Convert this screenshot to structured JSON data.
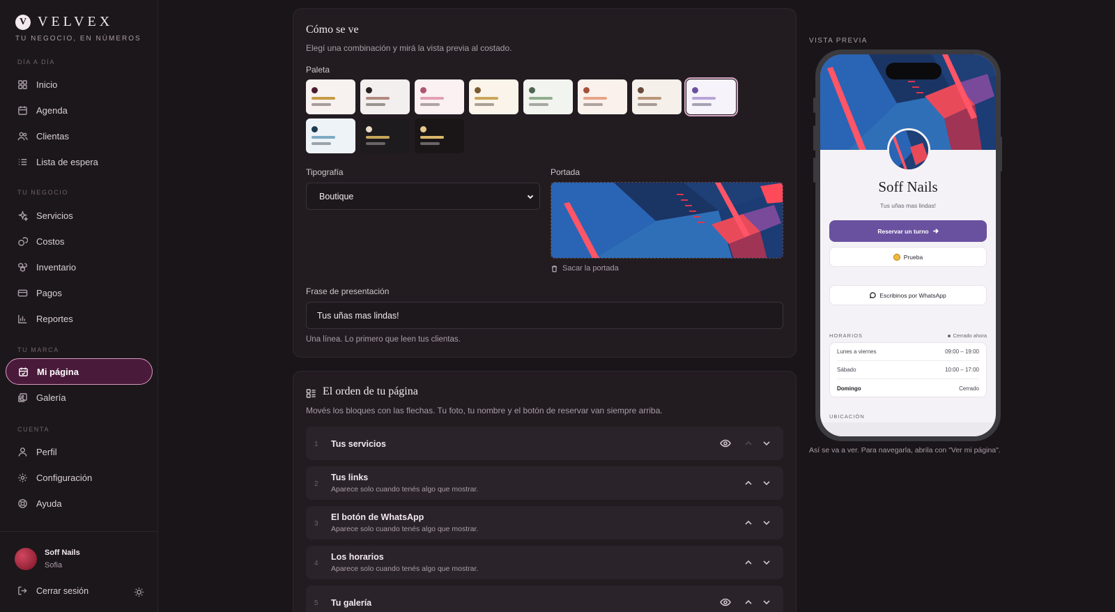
{
  "brand": {
    "name": "VELVEX",
    "logo_letter": "V",
    "tagline": "TU NEGOCIO, EN NÚMEROS"
  },
  "sidebar": {
    "sections": {
      "dia": "DÍA A DÍA",
      "negocio": "TU NEGOCIO",
      "marca": "TU MARCA",
      "cuenta": "CUENTA"
    },
    "items": {
      "inicio": "Inicio",
      "agenda": "Agenda",
      "clientas": "Clientas",
      "espera": "Lista de espera",
      "servicios": "Servicios",
      "costos": "Costos",
      "inventario": "Inventario",
      "pagos": "Pagos",
      "reportes": "Reportes",
      "pagina": "Mi página",
      "galeria": "Galería",
      "perfil": "Perfil",
      "config": "Configuración",
      "ayuda": "Ayuda"
    },
    "active": "pagina",
    "user": {
      "name": "Soff Nails",
      "sub": "Sofia"
    },
    "logout": "Cerrar sesión"
  },
  "appearance": {
    "title": "Cómo se ve",
    "subtitle": "Elegí una combinación y mirá la vista previa al costado.",
    "palette_label": "Paleta",
    "palettes": [
      {
        "bg": "#f7f1ef",
        "dot": "#4a1a30",
        "l1": "#c79a45",
        "l2": "#a89d9a"
      },
      {
        "bg": "#f3efee",
        "dot": "#2a1f22",
        "l1": "#b08a7e",
        "l2": "#9a928f"
      },
      {
        "bg": "#fbf0f2",
        "dot": "#b0566e",
        "l1": "#e3a0b3",
        "l2": "#b0a2a6"
      },
      {
        "bg": "#faf4ea",
        "dot": "#7a5a30",
        "l1": "#c9a55a",
        "l2": "#aaa095"
      },
      {
        "bg": "#f2f4ef",
        "dot": "#4d6650",
        "l1": "#8fae8c",
        "l2": "#a4a9a2"
      },
      {
        "bg": "#fbf1ec",
        "dot": "#a5513a",
        "l1": "#e6a48a",
        "l2": "#b0a29c"
      },
      {
        "bg": "#f6f0ea",
        "dot": "#6a4a3a",
        "l1": "#b8957a",
        "l2": "#a69b94"
      },
      {
        "bg": "#f6f3fa",
        "dot": "#6a51a0",
        "l1": "#b9a4d8",
        "l2": "#a7a2b2",
        "selected": true
      },
      {
        "bg": "#eef3f7",
        "dot": "#1e3a4e",
        "l1": "#7eaac4",
        "l2": "#9aa3a9"
      },
      {
        "bg": "#1e1b1e",
        "dot": "#e8dcc8",
        "l1": "#c9a55a",
        "l2": "#6a6466"
      },
      {
        "bg": "#1a1617",
        "dot": "#e5c98a",
        "l1": "#d9b66a",
        "l2": "#6a6466"
      }
    ],
    "typography_label": "Tipografía",
    "typography_value": "Boutique",
    "cover_label": "Portada",
    "remove_cover": "Sacar la portada",
    "phrase_label": "Frase de presentación",
    "phrase_value": "Tus uñas mas lindas!",
    "phrase_hint": "Una línea. Lo primero que leen tus clientas."
  },
  "order": {
    "title": "El orden de tu página",
    "subtitle": "Movés los bloques con las flechas. Tu foto, tu nombre y el botón de reservar van siempre arriba.",
    "rows": [
      {
        "num": "1",
        "title": "Tus servicios",
        "desc": ""
      },
      {
        "num": "2",
        "title": "Tus links",
        "desc": "Aparece solo cuando tenés algo que mostrar."
      },
      {
        "num": "3",
        "title": "El botón de WhatsApp",
        "desc": "Aparece solo cuando tenés algo que mostrar."
      },
      {
        "num": "4",
        "title": "Los horarios",
        "desc": "Aparece solo cuando tenés algo que mostrar."
      },
      {
        "num": "5",
        "title": "Tu galería",
        "desc": ""
      }
    ]
  },
  "preview": {
    "label": "VISTA PREVIA",
    "name": "Soff Nails",
    "tagline": "Tus uñas mas lindas!",
    "book": "Reservar un turno",
    "link": "Prueba",
    "whatsapp": "Escribinos por WhatsApp",
    "hours_title": "HORARIOS",
    "closed_now": "Cerrado ahora",
    "hours": [
      {
        "day": "Lunes a viernes",
        "time": "09:00 – 19:00"
      },
      {
        "day": "Sábado",
        "time": "10:00 – 17:00"
      },
      {
        "day": "Domingo",
        "time": "Cerrado"
      }
    ],
    "location_title": "UBICACIÓN",
    "caption": "Así se va a ver. Para navegarla, abrila con \"Ver mi página\"."
  },
  "colors": {
    "accent": "#6a51a0",
    "active_nav": "#4a1a3a",
    "active_border": "#d89ac0"
  }
}
